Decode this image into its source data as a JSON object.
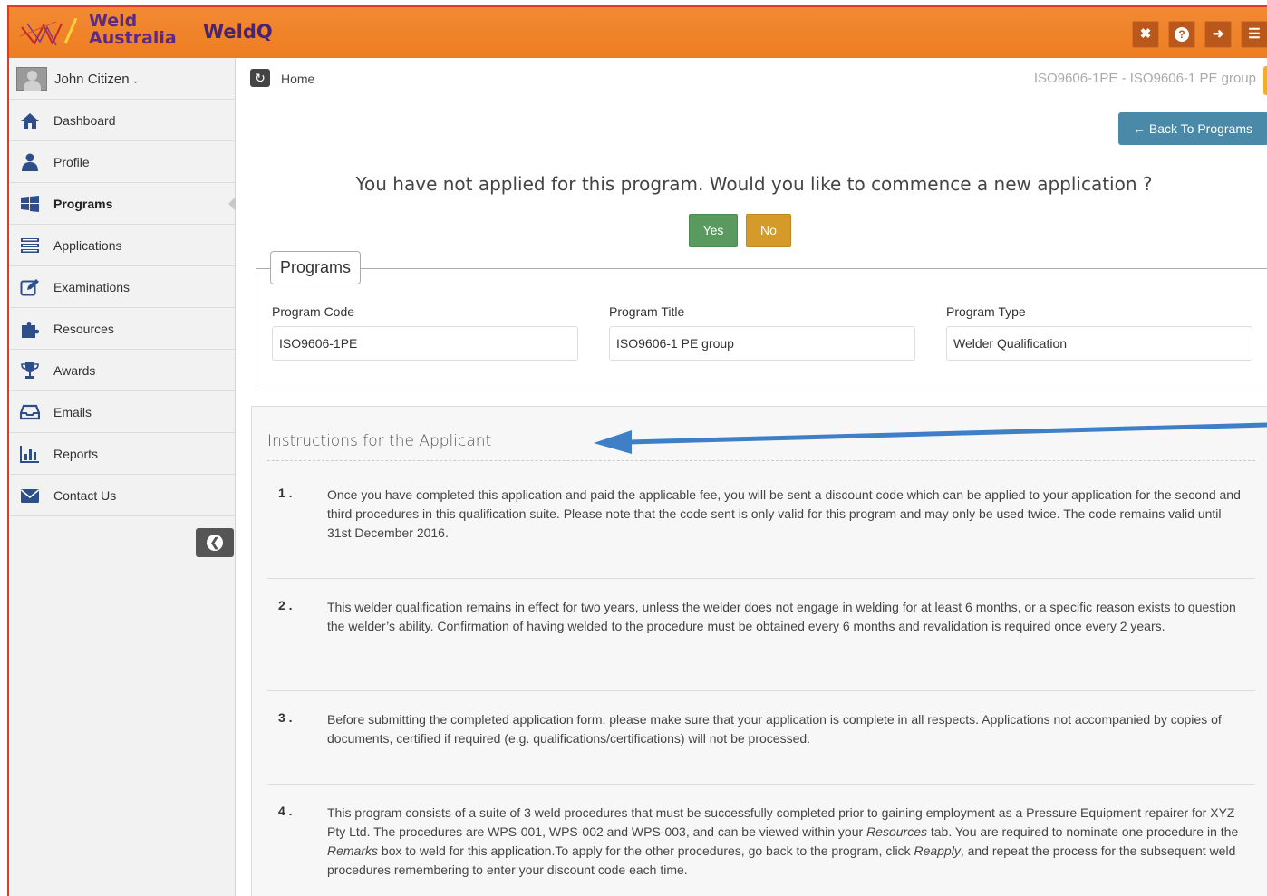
{
  "brand": {
    "logo_line1": "Weld",
    "logo_line2": "Australia",
    "app_name": "WeldQ"
  },
  "toolbar": {
    "fullscreen_icon": "expand-icon",
    "help_icon": "question-icon",
    "logout_icon": "logout-icon",
    "menu_icon": "hamburger-icon"
  },
  "user": {
    "name": "John Citizen"
  },
  "sidebar": {
    "items": [
      {
        "label": "Dashboard",
        "icon": "home-icon"
      },
      {
        "label": "Profile",
        "icon": "user-icon"
      },
      {
        "label": "Programs",
        "icon": "windows-icon"
      },
      {
        "label": "Applications",
        "icon": "list-icon"
      },
      {
        "label": "Examinations",
        "icon": "edit-icon"
      },
      {
        "label": "Resources",
        "icon": "puzzle-icon"
      },
      {
        "label": "Awards",
        "icon": "trophy-icon"
      },
      {
        "label": "Emails",
        "icon": "inbox-icon"
      },
      {
        "label": "Reports",
        "icon": "bar-chart-icon"
      },
      {
        "label": "Contact Us",
        "icon": "envelope-icon"
      }
    ]
  },
  "breadcrumb": {
    "home": "Home",
    "context": "ISO9606-1PE - ISO9606-1 PE group"
  },
  "actions": {
    "back_label": "Back To Programs",
    "question": "You have not applied for this program. Would you like to commence a new application ?",
    "yes_label": "Yes",
    "no_label": "No"
  },
  "programs": {
    "legend": "Programs",
    "code_label": "Program Code",
    "code_value": "ISO9606-1PE",
    "title_label": "Program Title",
    "title_value": "ISO9606-1 PE group",
    "type_label": "Program Type",
    "type_value": "Welder Qualification"
  },
  "instructions": {
    "title": "Instructions for the Applicant",
    "items": [
      {
        "num": "1 .",
        "text": "Once you have completed this application and paid the applicable fee, you will be sent a discount code which can be applied to your application for the second and third procedures in this qualification suite. Please note that the code sent is only valid for this program and may only be used twice. The code remains valid until 31st December 2016."
      },
      {
        "num": "2 .",
        "text": "This welder qualification remains in effect for two years, unless the welder does not engage in welding for at least 6 months, or a specific reason exists to question the welder’s ability. Confirmation of having welded to the procedure must be obtained every 6 months and revalidation is required once every 2 years."
      },
      {
        "num": "3 .",
        "text": "Before submitting the completed application form, please make sure that your application is complete in all respects. Applications not accompanied by copies of documents, certified if required (e.g. qualifications/certifications) will not be processed."
      },
      {
        "num": "4 .",
        "text_parts": [
          "This program consists of a suite of 3 weld procedures that must be successfully completed prior to gaining employment as a Pressure Equipment repairer for XYZ Pty Ltd. The procedures are WPS-001, WPS-002 and WPS-003, and can be viewed within your ",
          "Resources",
          " tab. You are required to nominate one procedure in the ",
          "Remarks",
          " box to weld for this application.To apply for the other procedures, go back to the program, click ",
          "Reapply",
          ", and repeat the process for the subsequent weld procedures remembering to enter your discount code each time."
        ]
      }
    ]
  },
  "colors": {
    "topbar": "#ee7d22",
    "brand_purple": "#5b2a86",
    "back_button": "#4a8aa8",
    "yes_button": "#5a9a5f",
    "no_button": "#d49a2a",
    "annotation_arrow": "#3f7fc8"
  }
}
